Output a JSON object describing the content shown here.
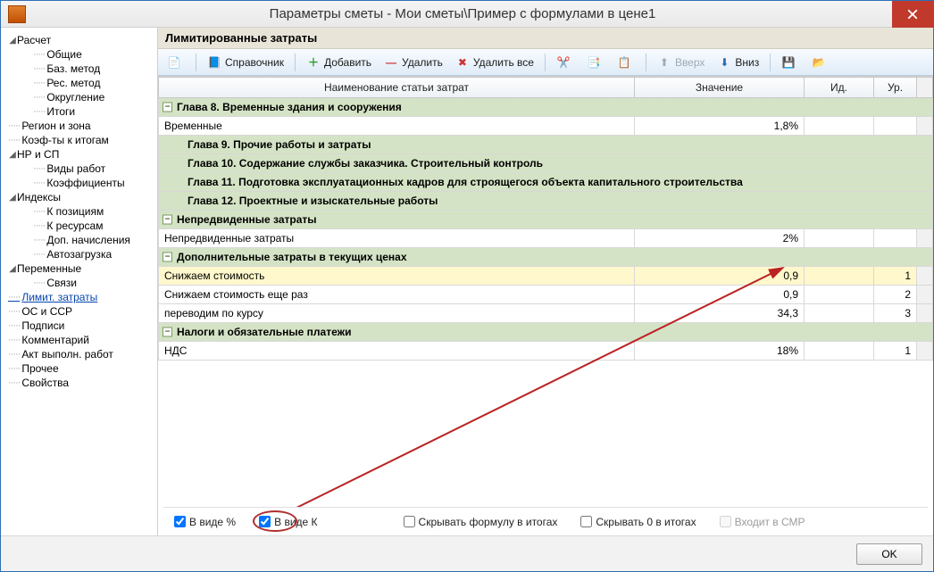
{
  "window": {
    "title": "Параметры сметы - Мои сметы\\Пример с формулами в цене1"
  },
  "sidebar": {
    "items": [
      {
        "t": "Расчет",
        "exp": "◢",
        "lvl": 1
      },
      {
        "t": "Общие",
        "lvl": 3
      },
      {
        "t": "Баз. метод",
        "lvl": 3
      },
      {
        "t": "Рес. метод",
        "lvl": 3
      },
      {
        "t": "Округление",
        "lvl": 3
      },
      {
        "t": "Итоги",
        "lvl": 3
      },
      {
        "t": "Регион и зона",
        "lvl": 2
      },
      {
        "t": "Коэф-ты к итогам",
        "lvl": 2
      },
      {
        "t": "НР и СП",
        "exp": "◢",
        "lvl": 1
      },
      {
        "t": "Виды работ",
        "lvl": 3
      },
      {
        "t": "Коэффициенты",
        "lvl": 3
      },
      {
        "t": "Индексы",
        "exp": "◢",
        "lvl": 1
      },
      {
        "t": "К позициям",
        "lvl": 3
      },
      {
        "t": "К ресурсам",
        "lvl": 3
      },
      {
        "t": "Доп. начисления",
        "lvl": 3
      },
      {
        "t": "Автозагрузка",
        "lvl": 3
      },
      {
        "t": "Переменные",
        "exp": "◢",
        "lvl": 1
      },
      {
        "t": "Связи",
        "lvl": 3
      },
      {
        "t": "Лимит. затраты",
        "lvl": 2,
        "selected": true
      },
      {
        "t": "ОС и ССР",
        "lvl": 2
      },
      {
        "t": "Подписи",
        "lvl": 2
      },
      {
        "t": "Комментарий",
        "lvl": 2
      },
      {
        "t": "Акт выполн. работ",
        "lvl": 2
      },
      {
        "t": "Прочее",
        "lvl": 2
      },
      {
        "t": "Свойства",
        "lvl": 2
      }
    ]
  },
  "panel": {
    "header": "Лимитированные затраты"
  },
  "toolbar": {
    "reference": "Справочник",
    "add": "Добавить",
    "delete": "Удалить",
    "delete_all": "Удалить все",
    "up": "Вверх",
    "down": "Вниз"
  },
  "grid": {
    "headers": {
      "name": "Наименование статьи затрат",
      "value": "Значение",
      "id": "Ид.",
      "level": "Ур."
    },
    "rows": [
      {
        "kind": "group",
        "name": "Глава 8. Временные здания и сооружения"
      },
      {
        "kind": "data",
        "name": "Временные",
        "value": "1,8%",
        "id": "",
        "lvl": ""
      },
      {
        "kind": "subgroup",
        "name": "Глава 9. Прочие работы и затраты"
      },
      {
        "kind": "subgroup",
        "name": "Глава 10. Содержание службы заказчика. Строительный контроль"
      },
      {
        "kind": "subgroup",
        "name": "Глава 11. Подготовка эксплуатационных кадров для строящегося объекта капитального строительства"
      },
      {
        "kind": "subgroup",
        "name": "Глава 12. Проектные и изыскательные работы"
      },
      {
        "kind": "group",
        "name": "Непредвиденные затраты"
      },
      {
        "kind": "data",
        "name": "Непредвиденные затраты",
        "value": "2%",
        "id": "",
        "lvl": ""
      },
      {
        "kind": "group",
        "name": "Дополнительные затраты в текущих ценах"
      },
      {
        "kind": "data",
        "name": "Снижаем стоимость",
        "value": "0,9",
        "id": "",
        "lvl": "1",
        "selected": true
      },
      {
        "kind": "data",
        "name": "Снижаем стоимость еще раз",
        "value": "0,9",
        "id": "",
        "lvl": "2"
      },
      {
        "kind": "data",
        "name": "переводим по курсу",
        "value": "34,3",
        "id": "",
        "lvl": "3"
      },
      {
        "kind": "group",
        "name": "Налоги и обязательные платежи"
      },
      {
        "kind": "data",
        "name": "НДС",
        "value": "18%",
        "id": "",
        "lvl": "1"
      }
    ]
  },
  "checks": {
    "as_percent": "В виде %",
    "as_coeff": "В виде К",
    "hide_formula": "Скрывать формулу в итогах",
    "hide_zero": "Скрывать 0 в итогах",
    "in_smr": "Входит в СМР"
  },
  "footer": {
    "ok": "OK"
  }
}
